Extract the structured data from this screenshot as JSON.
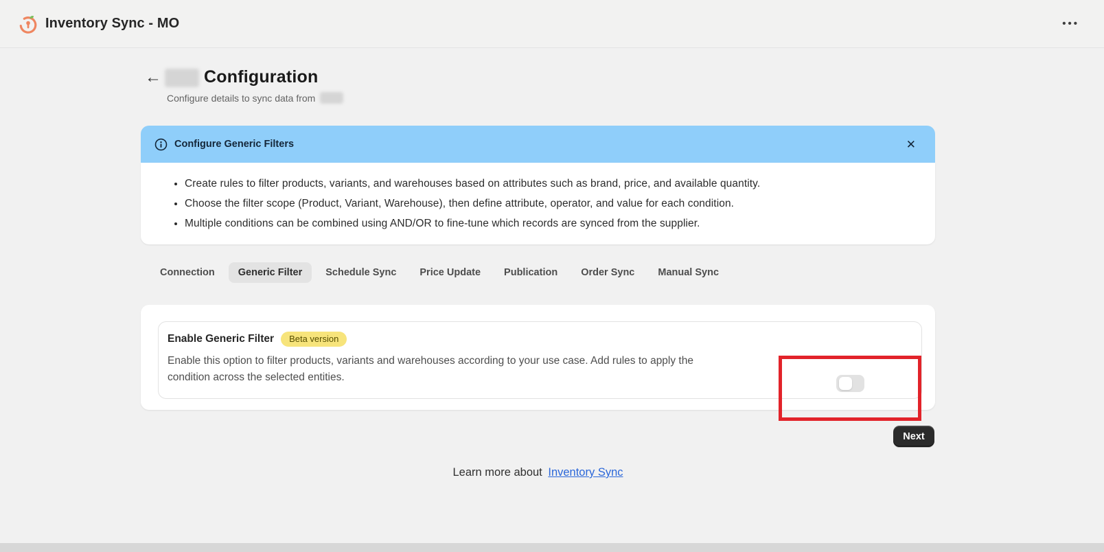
{
  "topbar": {
    "app_title": "Inventory Sync - MO"
  },
  "header": {
    "title": "Configuration",
    "subtitle": "Configure details to sync data from"
  },
  "banner": {
    "title": "Configure Generic Filters",
    "bullets": [
      "Create rules to filter products, variants, and warehouses based on attributes such as brand, price, and available quantity.",
      "Choose the filter scope (Product, Variant, Warehouse), then define attribute, operator, and value for each condition.",
      "Multiple conditions can be combined using AND/OR to fine-tune which records are synced from the supplier."
    ]
  },
  "tabs": [
    {
      "label": "Connection",
      "active": false
    },
    {
      "label": "Generic Filter",
      "active": true
    },
    {
      "label": "Schedule Sync",
      "active": false
    },
    {
      "label": "Price Update",
      "active": false
    },
    {
      "label": "Publication",
      "active": false
    },
    {
      "label": "Order Sync",
      "active": false
    },
    {
      "label": "Manual Sync",
      "active": false
    }
  ],
  "filter_section": {
    "title": "Enable Generic Filter",
    "badge_label": "Beta version",
    "description": "Enable this option to filter products, variants and warehouses according to your use case. Add rules to apply the condition across the selected entities.",
    "toggle_state": "off"
  },
  "actions": {
    "next_label": "Next"
  },
  "footer": {
    "text": "Learn more about",
    "link_label": "Inventory Sync"
  },
  "icons": {
    "back": "←",
    "close": "✕",
    "menu": "•••"
  },
  "colors": {
    "banner_bg": "#8FCEFA",
    "badge_bg": "#F7E47B",
    "highlight_red": "#E2232A",
    "link_blue": "#2A66D9",
    "next_button_bg": "#2B2B2B",
    "logo_orange": "#EF8660",
    "logo_leaf_green": "#7BBE5E"
  }
}
